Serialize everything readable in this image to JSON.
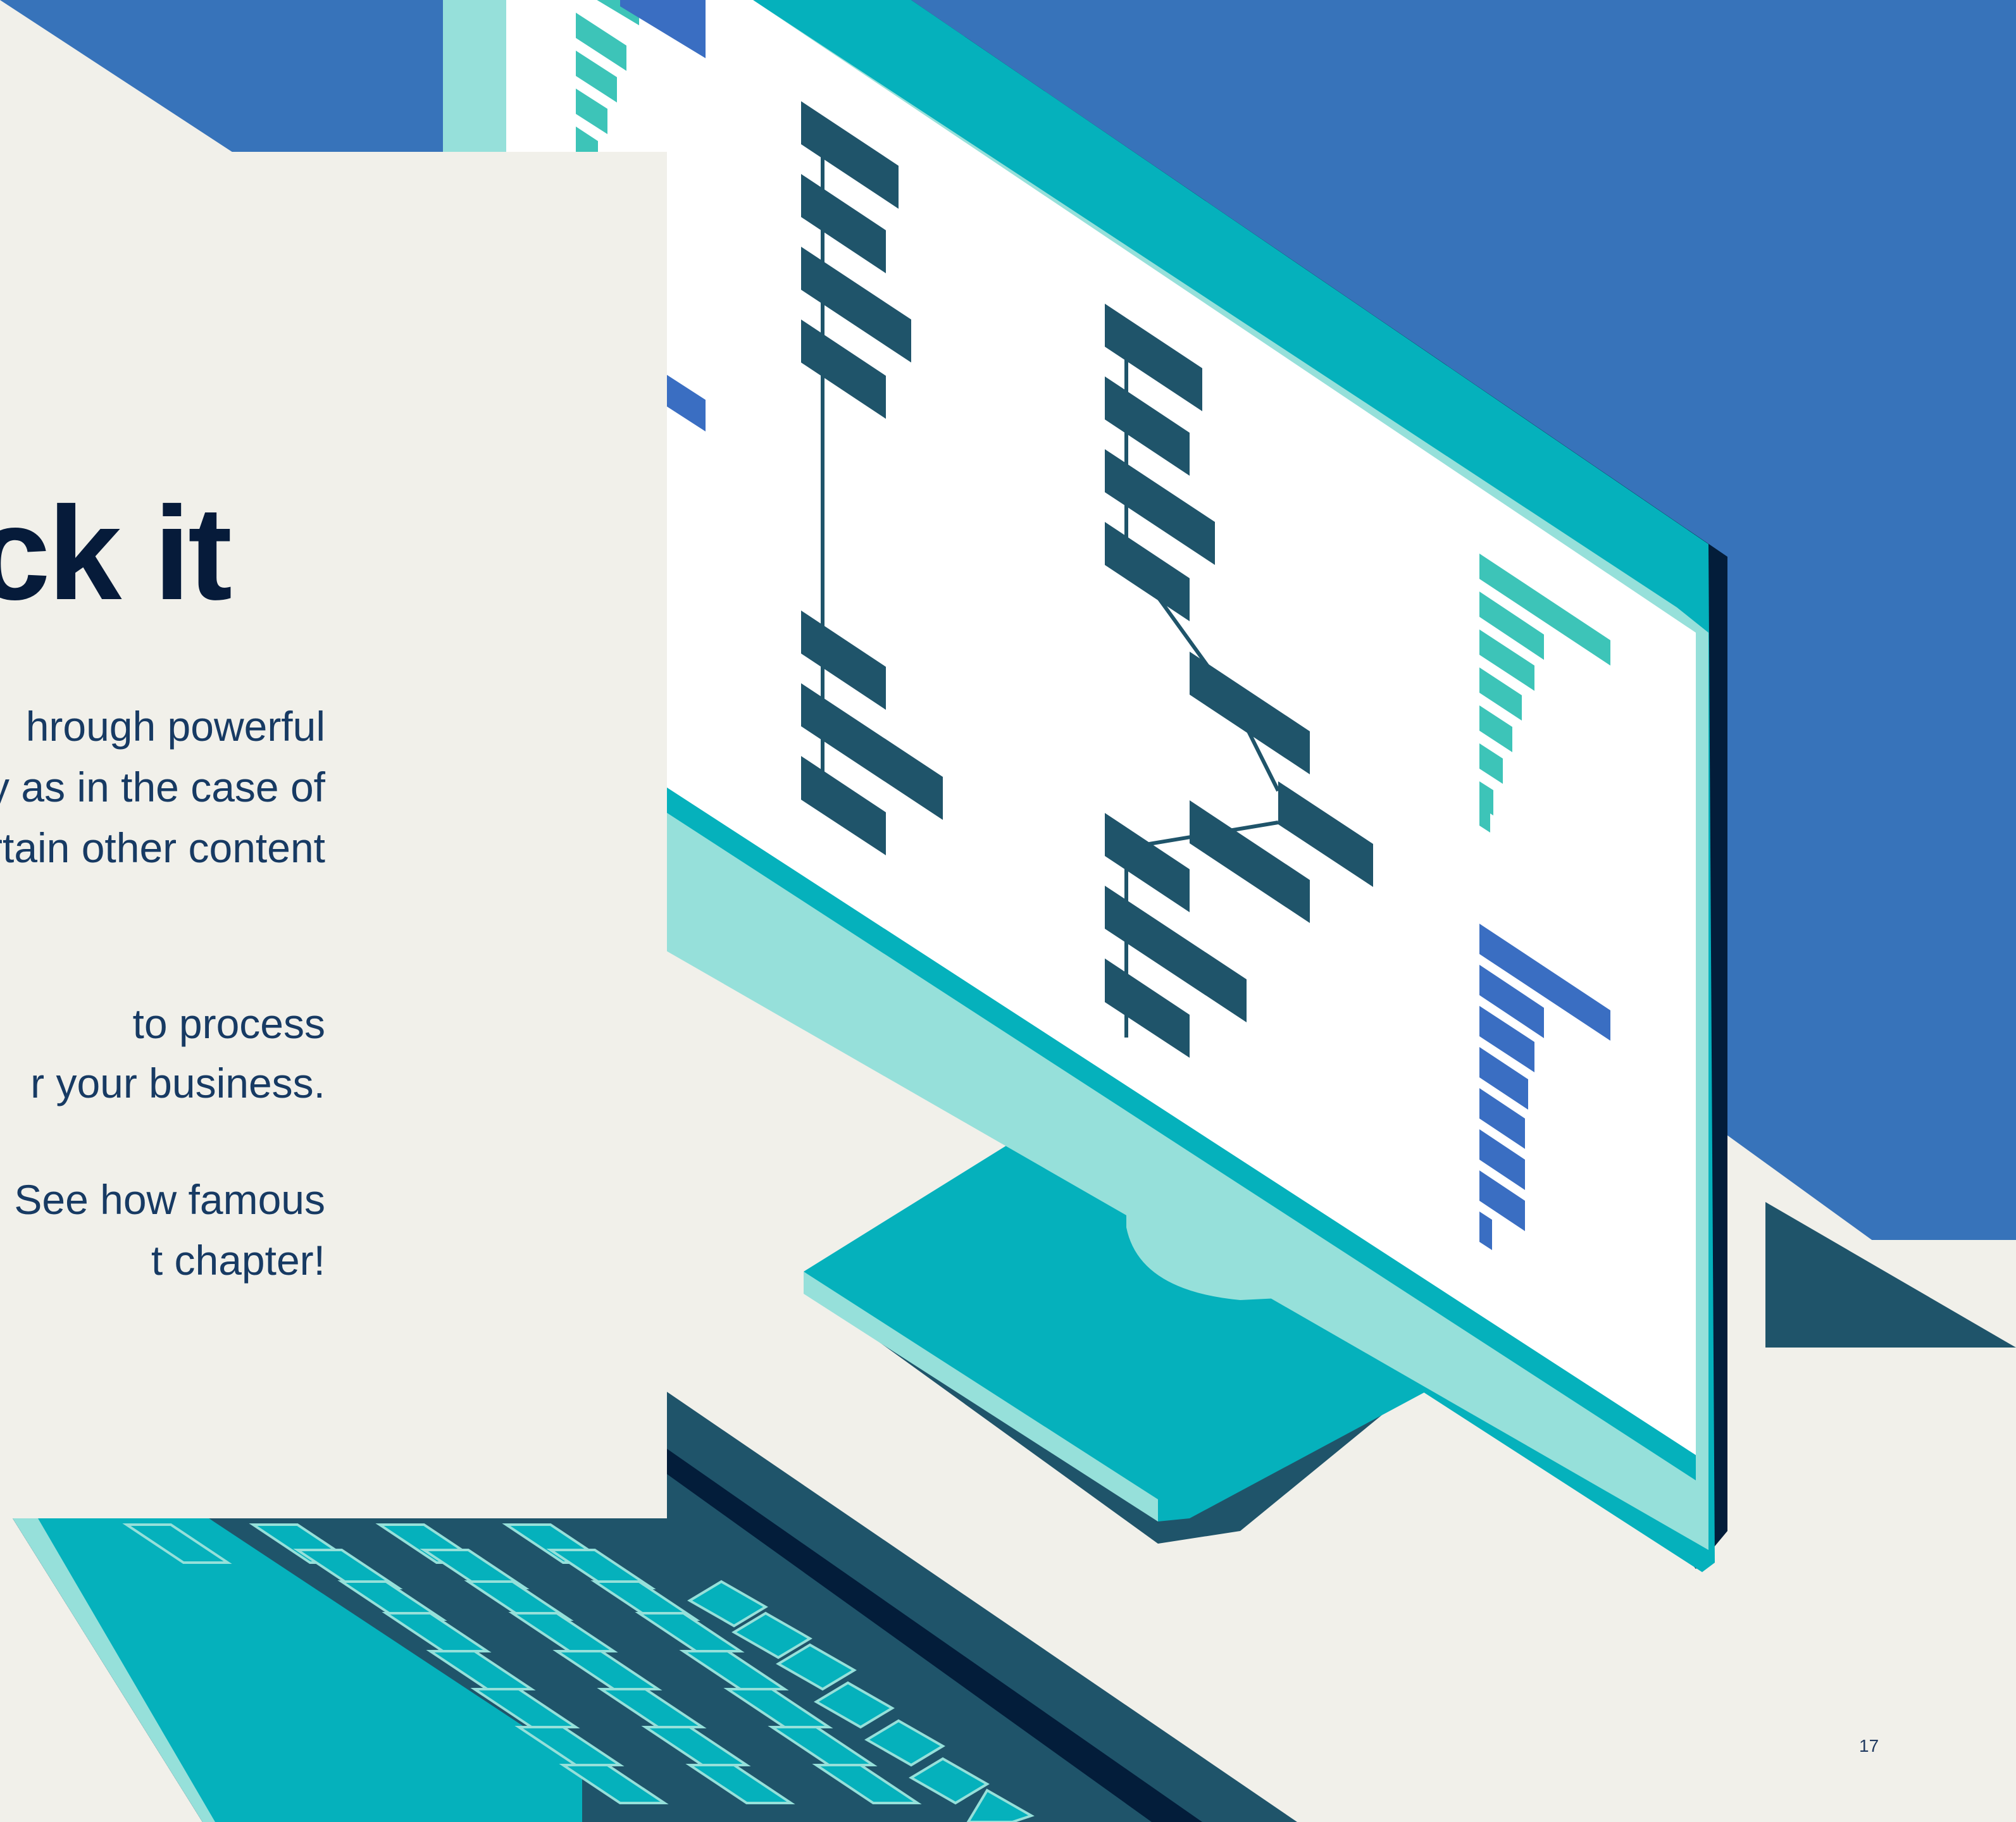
{
  "headline": "ck it",
  "body_lines": [
    "hrough powerful",
    "ly as in the case of",
    "rtain other content",
    "to process",
    "r your business.",
    "See how famous",
    "t chapter!"
  ],
  "page_number": "17",
  "illustration": {
    "subject": "isometric desktop computer with keyboard",
    "colors": {
      "background_blue": "#3773BA",
      "teal": "#05B1BC",
      "light_teal": "#96E0DA",
      "dark_teal": "#1F546A",
      "navy": "#031D3A",
      "screen": "#FFFFFF",
      "mint_bars": "#3DC4B8",
      "blue_bars": "#3A6EC2",
      "panel": "#F1F0EA"
    }
  }
}
